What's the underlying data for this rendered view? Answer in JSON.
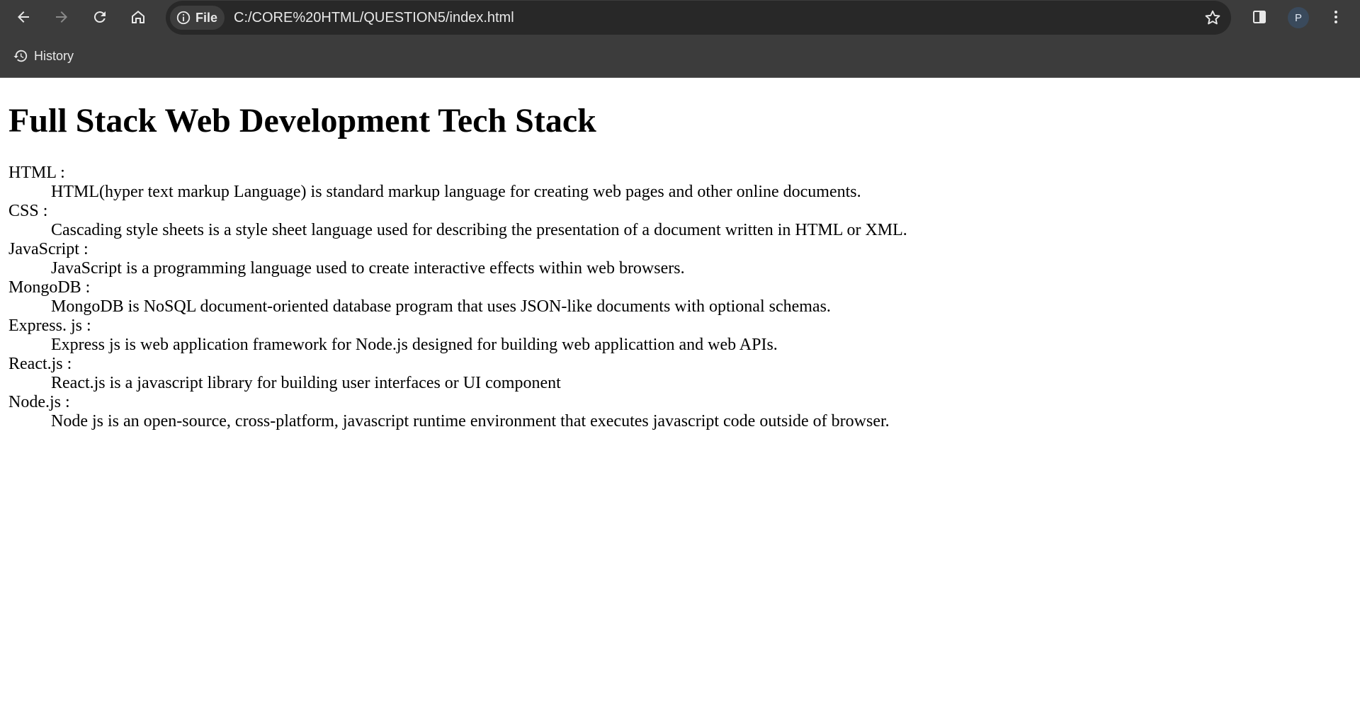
{
  "browser": {
    "site_chip_label": "File",
    "url": "C:/CORE%20HTML/QUESTION5/index.html",
    "avatar_letter": "P",
    "bookmark_label": "History"
  },
  "page": {
    "heading": "Full Stack Web Development Tech Stack",
    "terms": [
      {
        "term": "HTML :",
        "desc": "HTML(hyper text markup Language) is standard markup language for creating web pages and other online documents."
      },
      {
        "term": "CSS :",
        "desc": "Cascading style sheets is a style sheet language used for describing the presentation of a document written in HTML or XML."
      },
      {
        "term": "JavaScript :",
        "desc": "JavaScript is a programming language used to create interactive effects within web browsers."
      },
      {
        "term": "MongoDB :",
        "desc": "MongoDB is NoSQL document-oriented database program that uses JSON-like documents with optional schemas."
      },
      {
        "term": "Express. js :",
        "desc": "Express js is web application framework for Node.js designed for building web applicattion and web APIs."
      },
      {
        "term": "React.js :",
        "desc": "React.js is a javascript library for building user interfaces or UI component"
      },
      {
        "term": "Node.js :",
        "desc": "Node js is an open-source, cross-platform, javascript runtime environment that executes javascript code outside of browser."
      }
    ]
  },
  "icons": {
    "back": "arrow-left",
    "forward": "arrow-right",
    "reload": "refresh",
    "home": "home",
    "site_info": "info-circle",
    "bookmark": "star-outline",
    "side_panel": "side-panel",
    "menu": "three-dots-vertical",
    "history": "history-clock"
  },
  "colors": {
    "chrome_bg": "#3c3c3c",
    "omnibox_bg": "#282828",
    "chrome_text": "#e8e8e8",
    "forward_disabled": "#8a8a8a",
    "page_bg": "#ffffff",
    "page_text": "#000000"
  }
}
